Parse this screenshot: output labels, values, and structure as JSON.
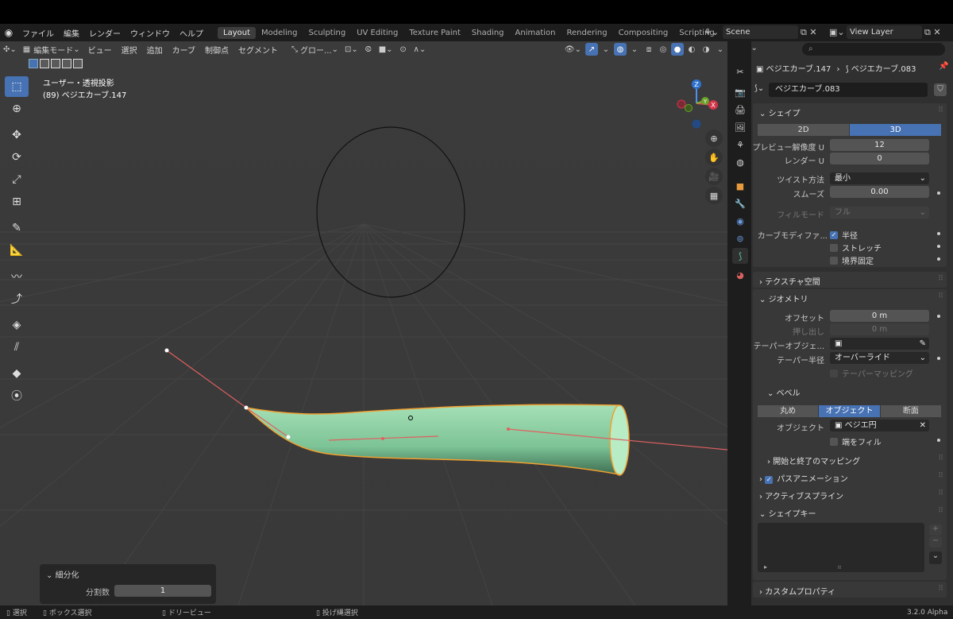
{
  "menu": {
    "items": [
      "ファイル",
      "編集",
      "レンダー",
      "ウィンドウ",
      "ヘルプ"
    ]
  },
  "workspaces": [
    {
      "label": "Layout",
      "active": true
    },
    {
      "label": "Modeling"
    },
    {
      "label": "Sculpting"
    },
    {
      "label": "UV Editing"
    },
    {
      "label": "Texture Paint"
    },
    {
      "label": "Shading"
    },
    {
      "label": "Animation"
    },
    {
      "label": "Rendering"
    },
    {
      "label": "Compositing"
    },
    {
      "label": "Scripting"
    }
  ],
  "add_workspace": "+",
  "scene": {
    "name": "Scene"
  },
  "view_layer": {
    "name": "View Layer"
  },
  "viewport_header": {
    "mode": "編集モード",
    "items": [
      "ビュー",
      "選択",
      "追加",
      "カーブ",
      "制御点",
      "セグメント"
    ],
    "transform_orientation": "グロー..."
  },
  "viewport_info": {
    "line1": "ユーザー・透視投影",
    "line2": "(89) ベジエカーブ.147"
  },
  "gizmo": {
    "z": "Z",
    "x": "X",
    "y": "Y"
  },
  "operator_panel": {
    "title": "細分化",
    "label": "分割数",
    "value": "1"
  },
  "status": {
    "select": "選択",
    "box_select": "ボックス選択",
    "drag_view": "ドリービュー",
    "lasso": "投げ縄選択",
    "version": "3.2.0 Alpha"
  },
  "properties": {
    "search_placeholder": "",
    "breadcrumb_object": "ベジエカーブ.147",
    "breadcrumb_data": "ベジエカーブ.083",
    "datablock_name": "ベジエカーブ.083",
    "shape": {
      "title": "シェイプ",
      "dim_2d": "2D",
      "dim_3d": "3D",
      "preview_u_label": "プレビュー解像度 U",
      "preview_u": "12",
      "render_u_label": "レンダー U",
      "render_u": "0",
      "twist_label": "ツイスト方法",
      "twist": "最小",
      "smooth_label": "スムーズ",
      "smooth": "0.00",
      "fill_label": "フィルモード",
      "fill": "フル",
      "modifier_label": "カーブモディファ...",
      "radius": "半径",
      "stretch": "ストレッチ",
      "bounds": "境界固定"
    },
    "texture_space": {
      "title": "テクスチャ空間"
    },
    "geometry": {
      "title": "ジオメトリ",
      "offset_label": "オフセット",
      "offset": "0 m",
      "extrude_label": "押し出し",
      "extrude": "0 m",
      "taper_obj_label": "テーパーオブジェ...",
      "taper_radius_label": "テーパー半径",
      "taper_radius": "オーバーライド",
      "taper_mapping": "テーパーマッピング"
    },
    "bevel": {
      "title": "ベベル",
      "round": "丸め",
      "object": "オブジェクト",
      "profile": "断面",
      "object_label": "オブジェクト",
      "object_value": "ベジエ円",
      "fill_caps": "端をフィル"
    },
    "start_end": {
      "title": "開始と終了のマッピング"
    },
    "path_anim": {
      "title": "パスアニメーション"
    },
    "active_spline": {
      "title": "アクティブスプライン"
    },
    "shape_keys": {
      "title": "シェイプキー"
    },
    "custom_props": {
      "title": "カスタムプロパティ"
    }
  },
  "colors": {
    "accent": "#4772b3",
    "tube": "#8fd5a6",
    "outline": "#f0a030",
    "handle": "#e06060"
  }
}
